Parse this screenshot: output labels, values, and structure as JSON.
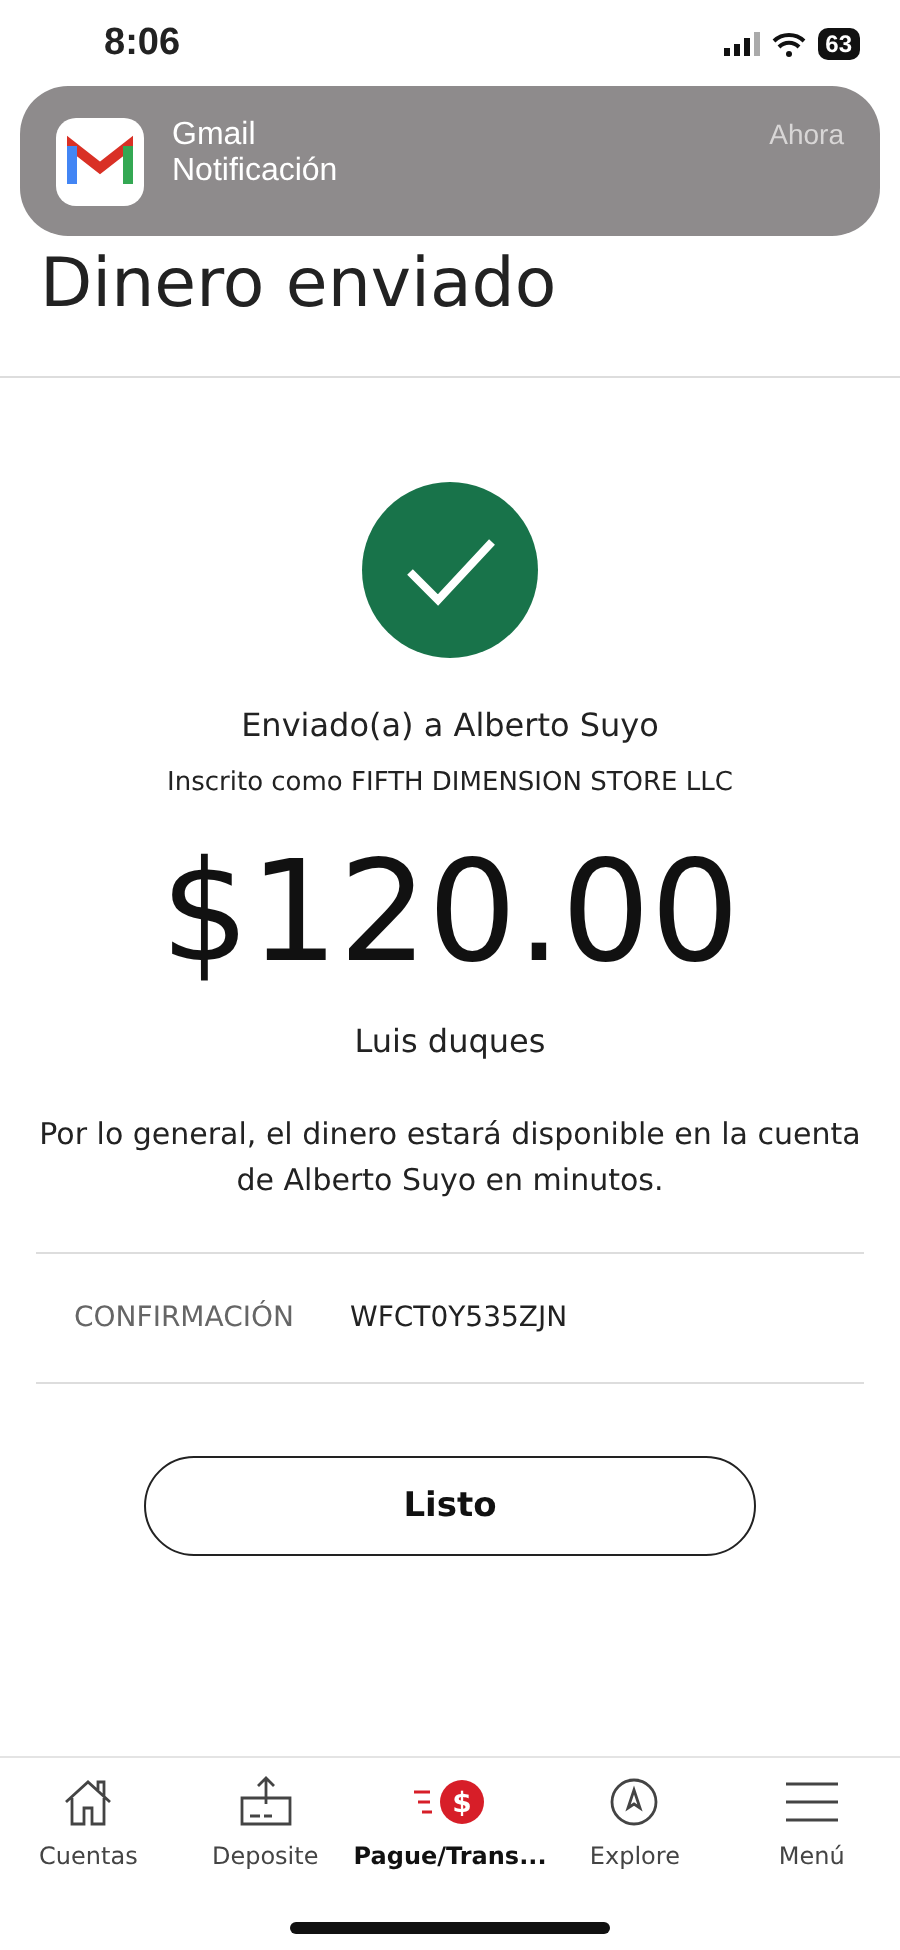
{
  "status_bar": {
    "time": "8:06",
    "battery": "63"
  },
  "notification": {
    "app": "Gmail",
    "message": "Notificación",
    "time": "Ahora"
  },
  "title": "Dinero enviado",
  "recipient": "Enviado(a) a Alberto Suyo",
  "enrolled": "Inscrito como FIFTH DIMENSION STORE LLC",
  "amount": "$120.00",
  "memo": "Luis duques",
  "note": "Por lo general, el dinero estará disponible en la cuenta de Alberto Suyo en minutos.",
  "confirmation": {
    "label": "CONFIRMACIÓN",
    "value": "WFCT0Y535ZJN"
  },
  "done_button": "Listo",
  "tabs": [
    {
      "kind": "home",
      "label": "Cuentas",
      "selected": false
    },
    {
      "kind": "deposit",
      "label": "Deposite",
      "selected": false
    },
    {
      "kind": "pay",
      "label": "Pague/Trans...",
      "icon_text": "$",
      "selected": true
    },
    {
      "kind": "explore",
      "label": "Explore",
      "selected": false
    },
    {
      "kind": "menu",
      "label": "Menú",
      "selected": false
    }
  ]
}
